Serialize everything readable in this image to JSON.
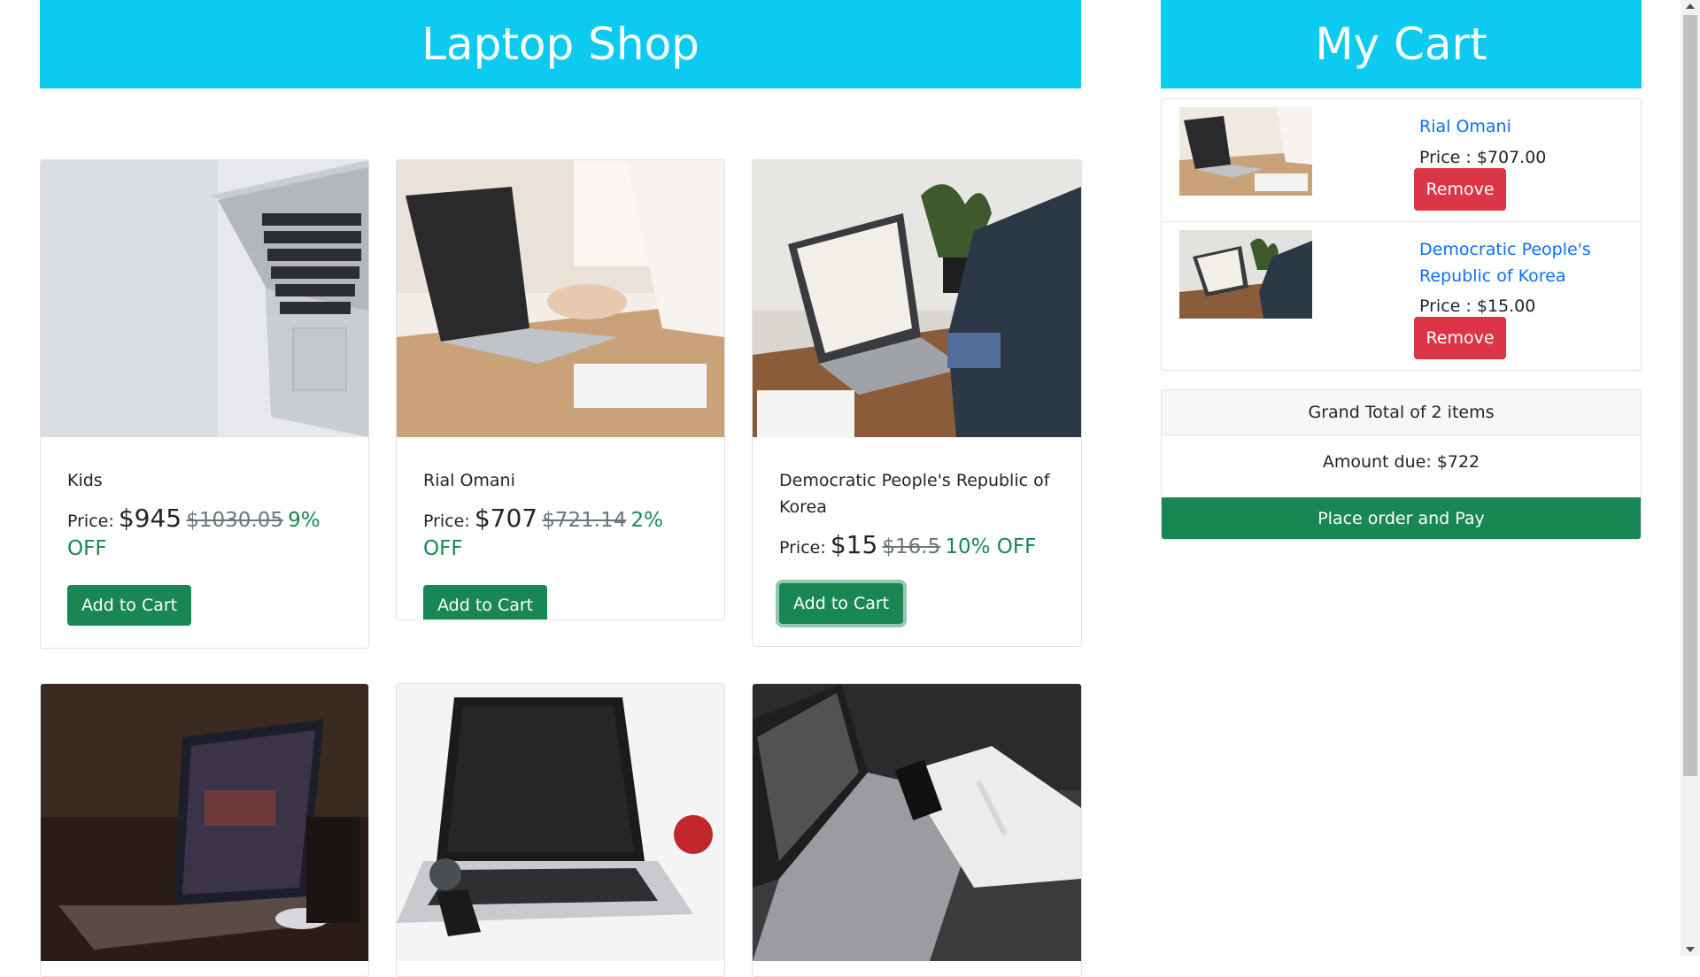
{
  "shop": {
    "title": "Laptop Shop",
    "price_label": "Price:",
    "add_to_cart_label": "Add to Cart",
    "products": [
      {
        "name": "Kids",
        "price": "$945",
        "old_price": "$1030.05",
        "discount": "9% OFF"
      },
      {
        "name": "Rial Omani",
        "price": "$707",
        "old_price": "$721.14",
        "discount": "2% OFF"
      },
      {
        "name": "Democratic People's Republic of Korea",
        "price": "$15",
        "old_price": "$16.5",
        "discount": "10% OFF"
      }
    ]
  },
  "cart": {
    "title": "My Cart",
    "remove_label": "Remove",
    "items": [
      {
        "name": "Rial Omani",
        "price": "Price : $707.00"
      },
      {
        "name": "Democratic People's Republic of Korea",
        "price": "Price : $15.00"
      }
    ],
    "grand_total": "Grand Total of 2 items",
    "amount_due": "Amount due: $722",
    "pay_label": "Place order and Pay"
  },
  "colors": {
    "banner": "#0dcaf0",
    "success": "#198754",
    "danger": "#dc3545",
    "link": "#0d6efd"
  }
}
